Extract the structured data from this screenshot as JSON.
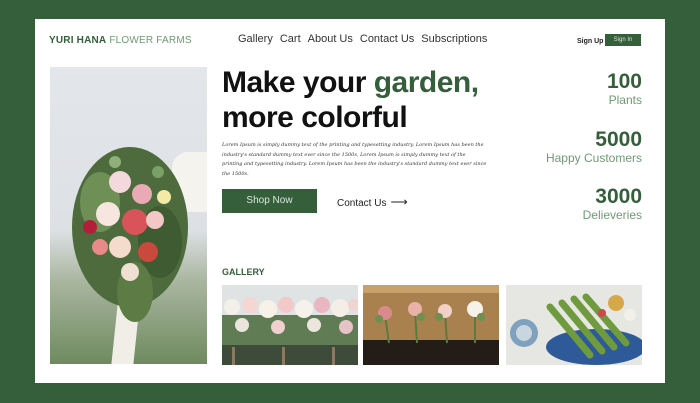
{
  "nav": {
    "brand_strong": "YURI HANA",
    "brand_light": "FLOWER FARMS",
    "links": [
      "Gallery",
      "Cart",
      "About Us",
      "Contact Us",
      "Subscriptions"
    ],
    "signup": "Sign Up",
    "signin": "Sign In"
  },
  "hero": {
    "headline_a": "Make your ",
    "headline_accent": "garden,",
    "headline_b": "more colorful",
    "body": "Lorem Ipsum is simply dummy text of the printing and typesetting industry. Lorem Ipsum has been the industry's standard dummy text ever since the 1500s, Lorem Ipsum is simply dummy text of the printing and typesetting industry. Lorem Ipsum has been the industry's standard dummy text ever since the 1500s.",
    "shop_button": "Shop Now",
    "contact_link": "Contact Us",
    "arrow": "⟶"
  },
  "stats": [
    {
      "value": "100",
      "label": "Plants"
    },
    {
      "value": "5000",
      "label": "Happy Customers"
    },
    {
      "value": "3000",
      "label": "Delieveries"
    }
  ],
  "gallery": {
    "title": "GALLERY"
  },
  "colors": {
    "brand_green": "#355e3b",
    "light_green": "#6f9a74"
  }
}
